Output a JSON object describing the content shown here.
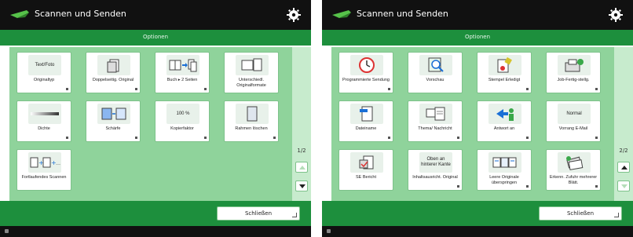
{
  "left": {
    "header": {
      "title": "Scannen und Senden"
    },
    "options_title": "Optionen",
    "page_indicator": "1/2",
    "buttons": [
      {
        "label": "Originaltyp",
        "icon_text": "Text/Foto",
        "icon": "document-type-icon"
      },
      {
        "label": "Doppelseitig. Original",
        "icon_text": "",
        "icon": "duplex-original-icon"
      },
      {
        "label": "Buch ▸ 2 Seiten",
        "icon_text": "",
        "icon": "book-to-two-pages-icon"
      },
      {
        "label": "Unterschiedl. Originalformate",
        "icon_text": "",
        "icon": "different-sizes-icon"
      },
      {
        "label": "Dichte",
        "icon_text": "",
        "icon": "density-slider-icon"
      },
      {
        "label": "Schärfe",
        "icon_text": "",
        "icon": "sharpness-icon"
      },
      {
        "label": "Kopierfaktor",
        "icon_text": "100 %",
        "icon": "copy-ratio-icon"
      },
      {
        "label": "Rahmen löschen",
        "icon_text": "",
        "icon": "erase-frame-icon"
      },
      {
        "label": "Fortlaufendes Scannen",
        "icon_text": "",
        "icon": "continuous-scan-icon"
      }
    ],
    "close_label": "Schließen"
  },
  "right": {
    "header": {
      "title": "Scannen und Senden"
    },
    "options_title": "Optionen",
    "page_indicator": "2/2",
    "buttons": [
      {
        "label": "Programmierte Sendung",
        "icon_text": "",
        "icon": "clock-icon"
      },
      {
        "label": "Vorschau",
        "icon_text": "",
        "icon": "preview-magnifier-icon"
      },
      {
        "label": "Stempel Erledigt",
        "icon_text": "",
        "icon": "done-stamp-icon"
      },
      {
        "label": "Job-Fertig-stellg.",
        "icon_text": "",
        "icon": "job-done-notice-icon"
      },
      {
        "label": "Dateiname",
        "icon_text": "",
        "icon": "file-name-icon"
      },
      {
        "label": "Thema/ Nachricht",
        "icon_text": "",
        "icon": "subject-message-icon"
      },
      {
        "label": "Antwort an",
        "icon_text": "",
        "icon": "reply-to-icon"
      },
      {
        "label": "Vorrang E-Mail",
        "icon_text": "Normal",
        "icon": "priority-icon"
      },
      {
        "label": "SE Bericht",
        "icon_text": "",
        "icon": "tx-report-icon"
      },
      {
        "label": "Inhaltsausricht. Original",
        "icon_text": "Oben an hinterer Kante",
        "icon": "orientation-icon"
      },
      {
        "label": "Leere Originale überspringen",
        "icon_text": "",
        "icon": "skip-blank-icon"
      },
      {
        "label": "Erkenn. Zufuhr mehrerer Blätt.",
        "icon_text": "",
        "icon": "multifeed-detection-icon"
      }
    ],
    "close_label": "Schließen"
  }
}
